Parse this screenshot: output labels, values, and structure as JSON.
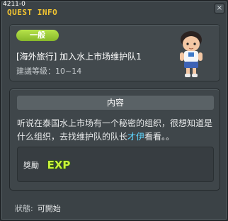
{
  "window": {
    "quest_id": "4211-0",
    "title": "QUEST INFO",
    "close_glyph": "×"
  },
  "quest": {
    "tag": "一般",
    "name": "[海外旅行] 加入水上市场维护队1",
    "level_requirement": "建議等級：10~14"
  },
  "content": {
    "header": "内容",
    "description_before": "听说在泰国水上市场有一个秘密的组织，很想知道是什么组织，去找维护队的队长",
    "npc_name": "才伊",
    "description_after": "看看。。"
  },
  "reward": {
    "label": "獎勵",
    "item": "EXP"
  },
  "status": {
    "label": "狀態:",
    "value": "可開始"
  },
  "colors": {
    "title": "#f3c531",
    "tag_green": "#9bcb36",
    "npc_name": "#5fd6ff",
    "exp": "#c9f23a"
  }
}
